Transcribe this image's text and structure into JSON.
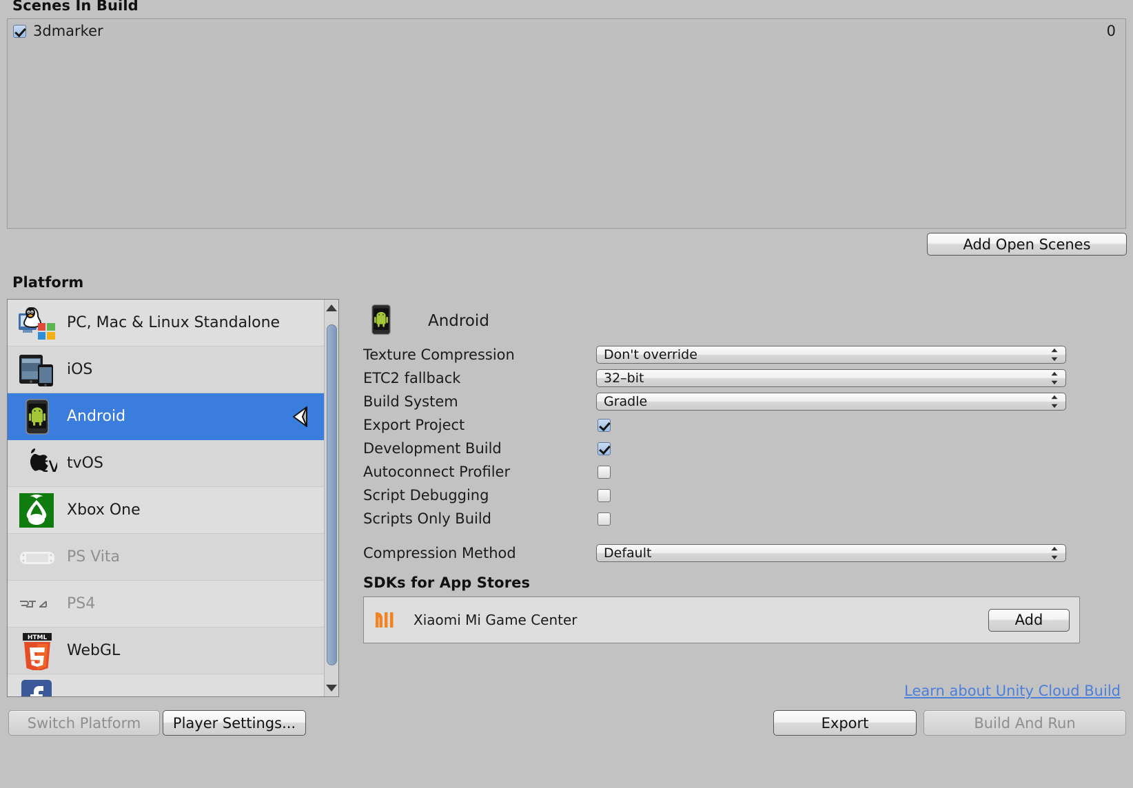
{
  "window": {
    "background_color": "#c2c2c2"
  },
  "scenes": {
    "header": "Scenes In Build",
    "rows": [
      {
        "name": "3dmarker",
        "index": "0",
        "checked": true
      }
    ],
    "add_open_scenes_label": "Add Open Scenes"
  },
  "platform": {
    "header": "Platform",
    "items": [
      {
        "label": "PC, Mac & Linux Standalone",
        "icon": "pc-mac-linux-icon",
        "selected": false,
        "dim": false
      },
      {
        "label": "iOS",
        "icon": "ios-icon",
        "selected": false,
        "dim": false
      },
      {
        "label": "Android",
        "icon": "android-icon",
        "selected": true,
        "dim": false
      },
      {
        "label": "tvOS",
        "icon": "tvos-icon",
        "selected": false,
        "dim": false
      },
      {
        "label": "Xbox One",
        "icon": "xbox-one-icon",
        "selected": false,
        "dim": false
      },
      {
        "label": "PS Vita",
        "icon": "ps-vita-icon",
        "selected": false,
        "dim": true
      },
      {
        "label": "PS4",
        "icon": "ps4-icon",
        "selected": false,
        "dim": true
      },
      {
        "label": "WebGL",
        "icon": "webgl-icon",
        "selected": false,
        "dim": false
      }
    ],
    "selected_marker_icon": "unity-logo-icon",
    "scrollbar": {
      "up_icon": "scroll-up-arrow-icon",
      "down_icon": "scroll-down-arrow-icon"
    }
  },
  "target": {
    "name": "Android",
    "icon": "android-phone-icon",
    "settings": [
      {
        "label": "Texture Compression",
        "type": "popup",
        "value": "Don't override"
      },
      {
        "label": "ETC2 fallback",
        "type": "popup",
        "value": "32–bit"
      },
      {
        "label": "Build System",
        "type": "popup",
        "value": "Gradle"
      },
      {
        "label": "Export Project",
        "type": "checkbox",
        "checked": true
      },
      {
        "label": "Development Build",
        "type": "checkbox",
        "checked": true
      },
      {
        "label": "Autoconnect Profiler",
        "type": "checkbox",
        "checked": false
      },
      {
        "label": "Script Debugging",
        "type": "checkbox",
        "checked": false
      },
      {
        "label": "Scripts Only Build",
        "type": "checkbox",
        "checked": false
      }
    ],
    "compression": {
      "label": "Compression Method",
      "value": "Default"
    },
    "sdk_header": "SDKs for App Stores",
    "sdk": {
      "name": "Xiaomi Mi Game Center",
      "icon": "xiaomi-mi-icon",
      "add_label": "Add"
    },
    "cloud_build_link": "Learn about Unity Cloud Build"
  },
  "footer": {
    "switch_platform": {
      "label": "Switch Platform",
      "enabled": false
    },
    "player_settings": {
      "label": "Player Settings...",
      "enabled": true
    },
    "export": {
      "label": "Export",
      "enabled": true
    },
    "build_and_run": {
      "label": "Build And Run",
      "enabled": false
    }
  },
  "colors": {
    "selection_blue": "#3b7ddd",
    "link_blue": "#4a7fdb",
    "panel_gray": "#c2c2c2",
    "list_gray": "#dedede"
  }
}
